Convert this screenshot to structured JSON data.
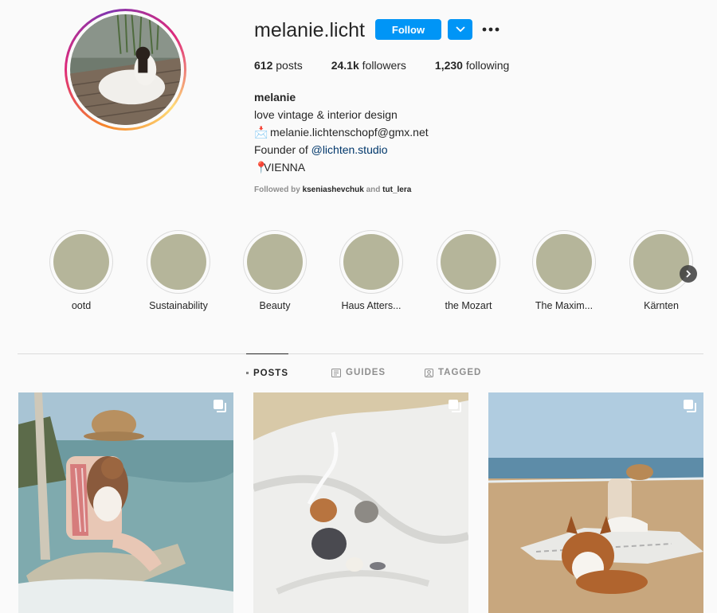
{
  "profile": {
    "username": "melanie.licht",
    "follow_label": "Follow",
    "stats": {
      "posts_count": "612",
      "posts_label": "posts",
      "followers_count": "24.1k",
      "followers_label": "followers",
      "following_count": "1,230",
      "following_label": "following"
    },
    "bio": {
      "name": "melanie",
      "line1": "love vintage & interior design",
      "email_emoji": "📩",
      "email": "melanie.lichtenschopf@gmx.net",
      "founder_prefix": "Founder of",
      "founder_link": "@lichten.studio",
      "location_emoji": "📍",
      "location": "VIENNA"
    },
    "followed_by": {
      "prefix": "Followed by",
      "user1": "kseniashevchuk",
      "and": "and",
      "user2": "tut_lera"
    }
  },
  "highlights": [
    {
      "label": "ootd"
    },
    {
      "label": "Sustainability"
    },
    {
      "label": "Beauty"
    },
    {
      "label": "Haus Atters..."
    },
    {
      "label": "the Mozart"
    },
    {
      "label": "The Maxim..."
    },
    {
      "label": "Kärnten"
    }
  ],
  "tabs": [
    {
      "label": "POSTS",
      "icon": "grid-icon",
      "active": true
    },
    {
      "label": "GUIDES",
      "icon": "guides-icon",
      "active": false
    },
    {
      "label": "TAGGED",
      "icon": "tagged-icon",
      "active": false
    }
  ],
  "posts": [
    {
      "icon": "multiple-images-icon"
    },
    {
      "icon": "multiple-images-icon"
    },
    {
      "icon": "multiple-images-icon"
    }
  ],
  "colors": {
    "accent": "#0095f6",
    "highlight_placeholder": "#b5b59a",
    "link": "#00376b",
    "muted": "#8e8e8e"
  }
}
